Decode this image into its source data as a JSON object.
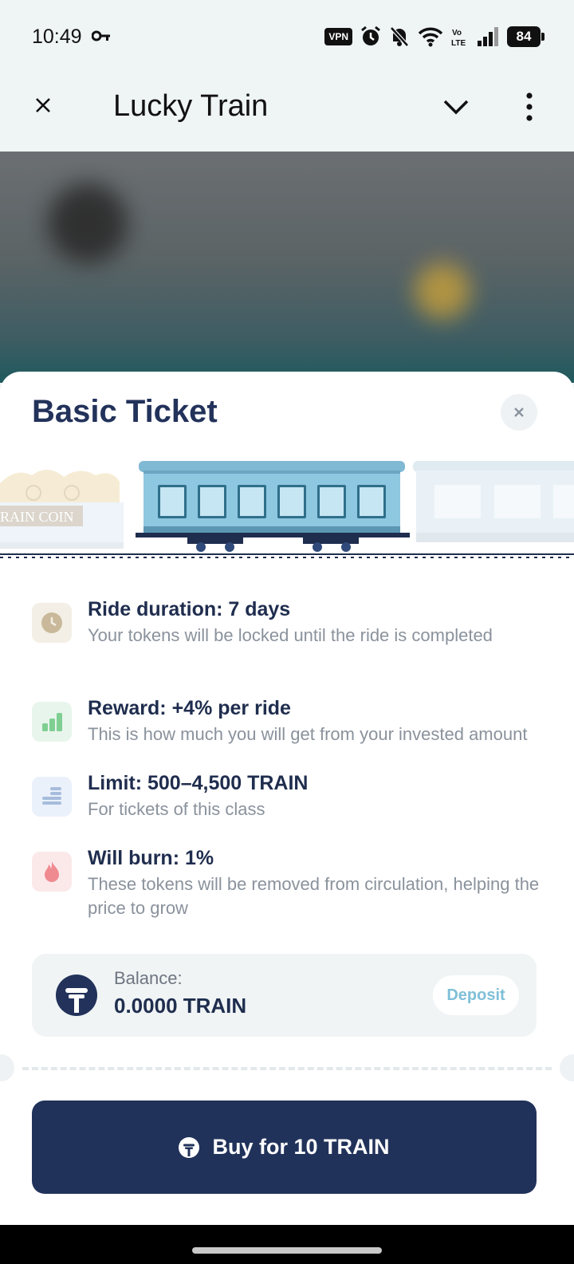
{
  "status_bar": {
    "time": "10:49",
    "vpn_label": "VPN",
    "battery": "84",
    "icons": [
      "key-icon",
      "vpn-icon",
      "alarm-icon",
      "mute-icon",
      "wifi-icon",
      "volte-icon",
      "signal-icon",
      "battery-icon"
    ]
  },
  "app_bar": {
    "title": "Lucky Train",
    "icons": [
      "close-icon",
      "chevron-down-icon",
      "more-vert-icon"
    ]
  },
  "sheet": {
    "title": "Basic Ticket",
    "train_sign": "RAIN COIN",
    "features": [
      {
        "icon": "clock-icon",
        "title": "Ride duration: 7 days",
        "desc": "Your tokens will be locked until the ride is completed",
        "icon_bg": "#f3efe6",
        "icon_color": "#c9b99a"
      },
      {
        "icon": "bar-chart-icon",
        "title": "Reward: +4% per ride",
        "desc": "This is how much you will get from your invested amount",
        "icon_bg": "#e8f5ec",
        "icon_color": "#7fcf93"
      },
      {
        "icon": "coin-stack-icon",
        "title": "Limit: 500–4,500 TRAIN",
        "desc": "For tickets of this class",
        "icon_bg": "#eaf1fb",
        "icon_color": "#a7bcdc"
      },
      {
        "icon": "flame-icon",
        "title": "Will burn: 1%",
        "desc": "These tokens will be removed from circulation, helping the price to grow",
        "icon_bg": "#fbe9ea",
        "icon_color": "#ef8a90"
      }
    ],
    "balance": {
      "label": "Balance:",
      "value": "0.0000 TRAIN",
      "deposit_label": "Deposit"
    },
    "buy_label": "Buy for 10 TRAIN"
  },
  "colors": {
    "primary": "#21325a",
    "accent": "#7fbfd8",
    "background": "#eff4f4"
  }
}
